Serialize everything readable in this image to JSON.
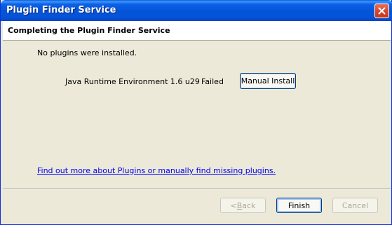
{
  "window": {
    "title": "Plugin Finder Service"
  },
  "header": {
    "title": "Completing the Plugin Finder Service"
  },
  "body": {
    "status_message": "No plugins were installed.",
    "plugins": [
      {
        "name": "Java Runtime Environment 1.6 u29",
        "status": "Failed",
        "action_label": "Manual Install"
      }
    ],
    "more_link": "Find out more about Plugins or manually find missing plugins."
  },
  "buttons": {
    "back_prefix": "< ",
    "back_underlined": "B",
    "back_suffix": "ack",
    "finish": "Finish",
    "cancel": "Cancel"
  },
  "icons": {
    "close": "close-icon"
  },
  "colors": {
    "titlebar": "#0554d8",
    "close": "#d7452b",
    "link": "#0000ee",
    "face": "#ece9d8"
  }
}
